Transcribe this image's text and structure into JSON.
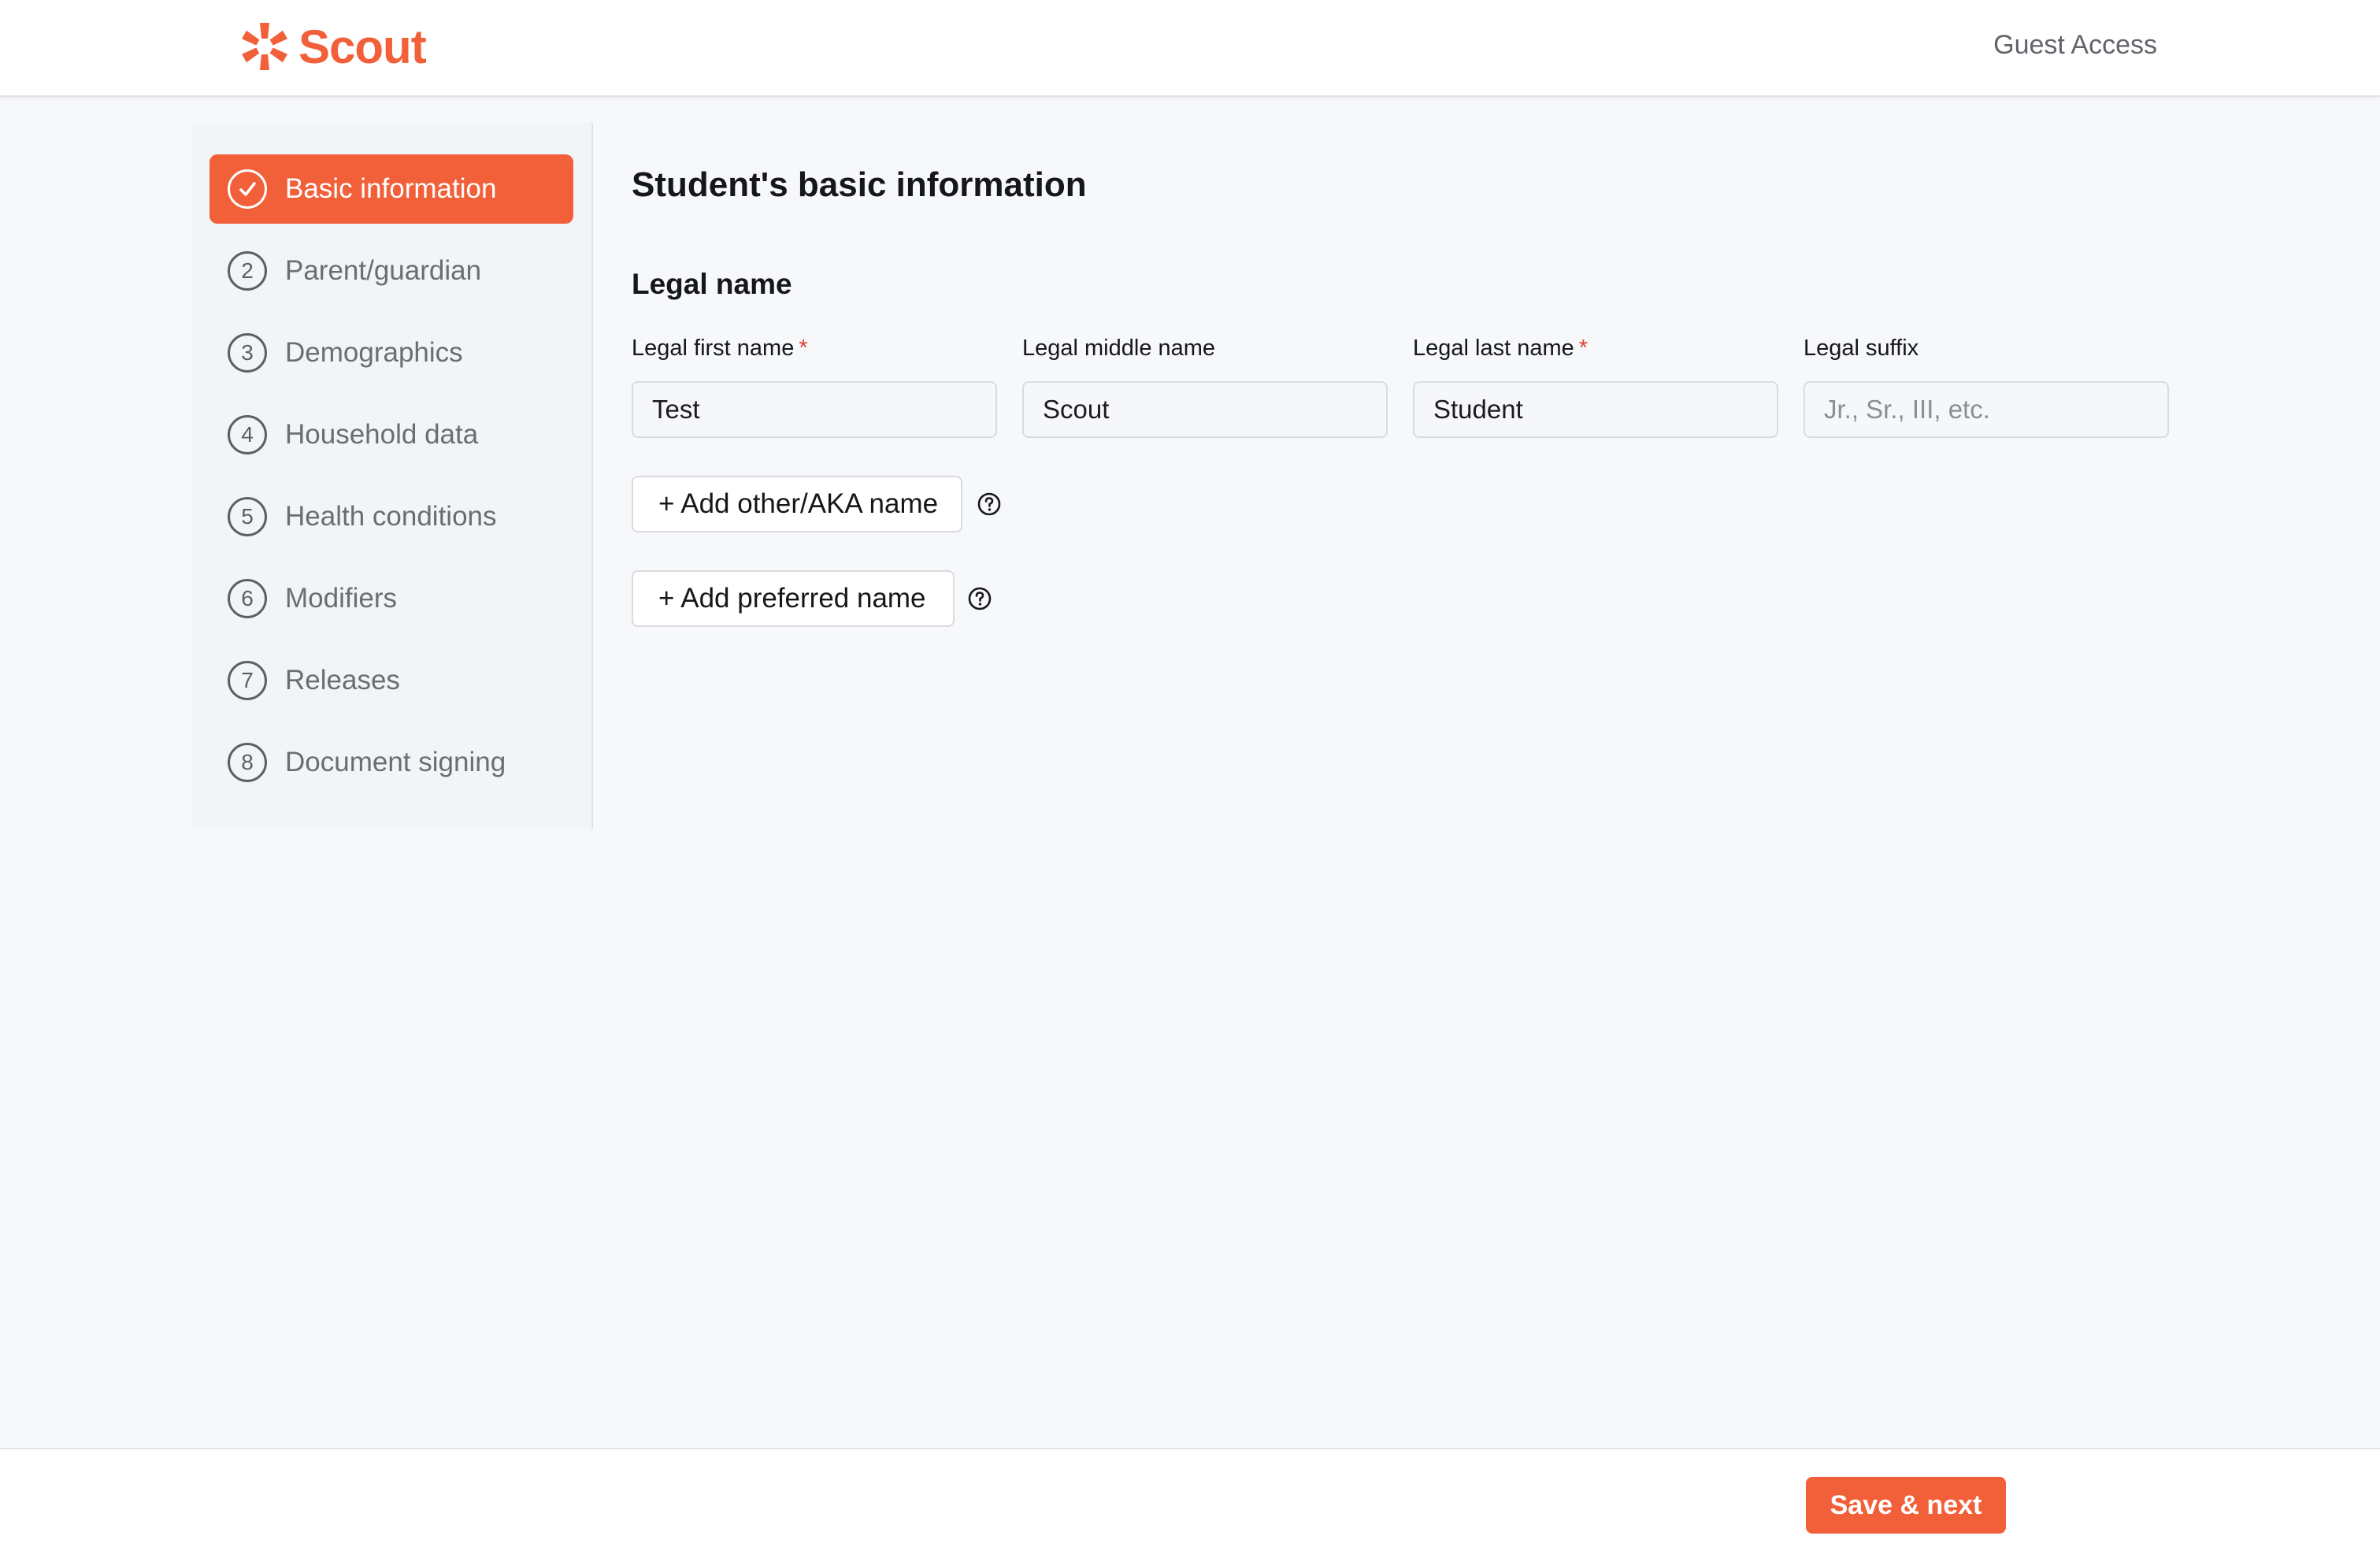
{
  "header": {
    "logo_text": "Scout",
    "guest_access": "Guest Access",
    "brand_color": "#f2603a"
  },
  "sidebar": {
    "items": [
      {
        "step": "✓",
        "label": "Basic information",
        "active": true,
        "icon": "check-circle-icon"
      },
      {
        "step": "2",
        "label": "Parent/guardian",
        "active": false
      },
      {
        "step": "3",
        "label": "Demographics",
        "active": false
      },
      {
        "step": "4",
        "label": "Household data",
        "active": false
      },
      {
        "step": "5",
        "label": "Health conditions",
        "active": false
      },
      {
        "step": "6",
        "label": "Modifiers",
        "active": false
      },
      {
        "step": "7",
        "label": "Releases",
        "active": false
      },
      {
        "step": "8",
        "label": "Document signing",
        "active": false
      }
    ]
  },
  "main": {
    "title": "Student's basic information",
    "section_title": "Legal name",
    "fields": [
      {
        "label": "Legal first name",
        "required": "*",
        "value": "Test",
        "placeholder": ""
      },
      {
        "label": "Legal middle name",
        "required": "",
        "value": "Scout",
        "placeholder": ""
      },
      {
        "label": "Legal last name",
        "required": "*",
        "value": "Student",
        "placeholder": ""
      },
      {
        "label": "Legal suffix",
        "required": "",
        "value": "",
        "placeholder": "Jr., Sr., III, etc."
      }
    ],
    "add_aka_label": "+ Add other/AKA name",
    "add_preferred_label": "+ Add preferred name",
    "help_icon": "question-circle-icon"
  },
  "footer": {
    "save_next_label": "Save & next"
  }
}
